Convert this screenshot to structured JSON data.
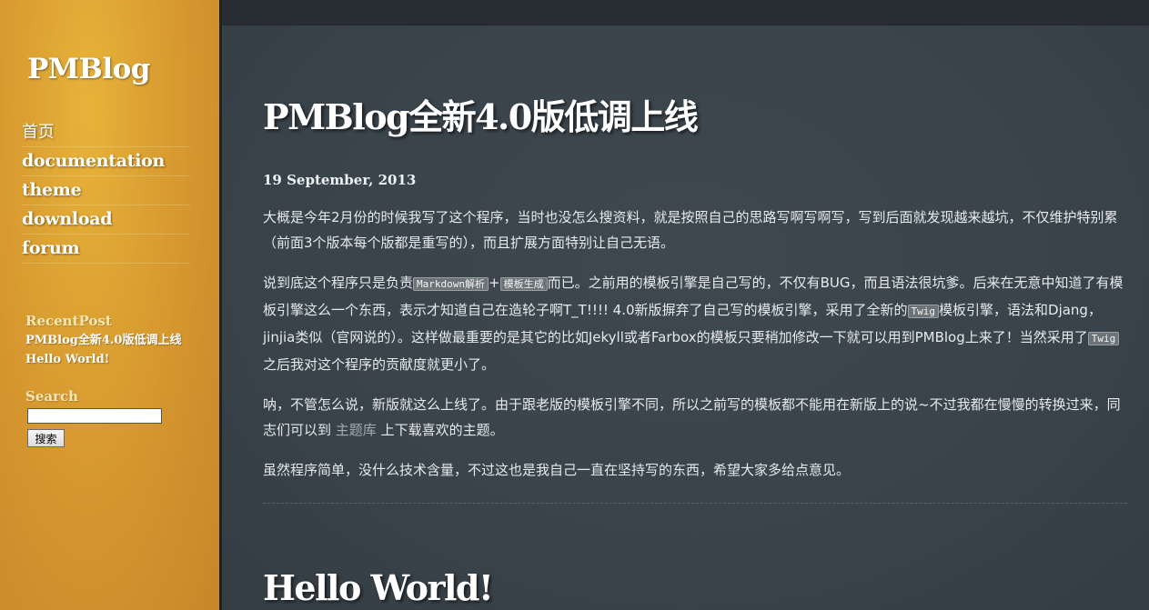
{
  "site": {
    "title": "PMBlog"
  },
  "nav": {
    "items": [
      {
        "label": "首页"
      },
      {
        "label": "documentation"
      },
      {
        "label": "theme"
      },
      {
        "label": "download"
      },
      {
        "label": "forum"
      }
    ]
  },
  "recent": {
    "title": "RecentPost",
    "posts": [
      {
        "label": "PMBlog全新4.0版低调上线"
      },
      {
        "label": "Hello World!"
      }
    ]
  },
  "search": {
    "title": "Search",
    "placeholder": "",
    "value": "",
    "button_label": "搜索"
  },
  "post1": {
    "title": "PMBlog全新4.0版低调上线",
    "date": "19 September, 2013",
    "p1": "大概是今年2月份的时候我写了这个程序，当时也没怎么搜资料，就是按照自己的思路写啊写啊写，写到后面就发现越来越坑，不仅维护特别累（前面3个版本每个版都是重写的），而且扩展方面特别让自己无语。",
    "p2": {
      "t1": "说到底这个程序只是负责",
      "code1": "Markdown解析",
      "t2": "+",
      "code2": "模板生成",
      "t3": "而已。之前用的模板引擎是自己写的，不仅有BUG，而且语法很坑爹。后来在无意中知道了有模板引擎这么一个东西，表示才知道自己在造轮子啊T_T!!!! 4.0新版摒弃了自己写的模板引擎，采用了全新的",
      "code3": "Twig",
      "t4": "模板引擎，语法和Djang，jinjia类似（官网说的）。这样做最重要的是其它的比如Jekyll或者Farbox的模板只要稍加修改一下就可以用到PMBlog上来了！当然采用了",
      "code4": "Twig",
      "t5": "之后我对这个程序的贡献度就更小了。"
    },
    "p3": {
      "t1": "呐，不管怎么说，新版就这么上线了。由于跟老版的模板引擎不同，所以之前写的模板都不能用在新版上的说~不过我都在慢慢的转换过来，同志们可以到 ",
      "link": "主题库",
      "t2": " 上下载喜欢的主题。"
    },
    "p4": "虽然程序简单，没什么技术含量，不过这也是我自己一直在坚持写的东西，希望大家多给点意见。"
  },
  "post2": {
    "title": "Hello World!"
  },
  "colors": {
    "sidebar": "#d99c30",
    "main_bg": "#39434a",
    "topbar": "#272d33"
  }
}
